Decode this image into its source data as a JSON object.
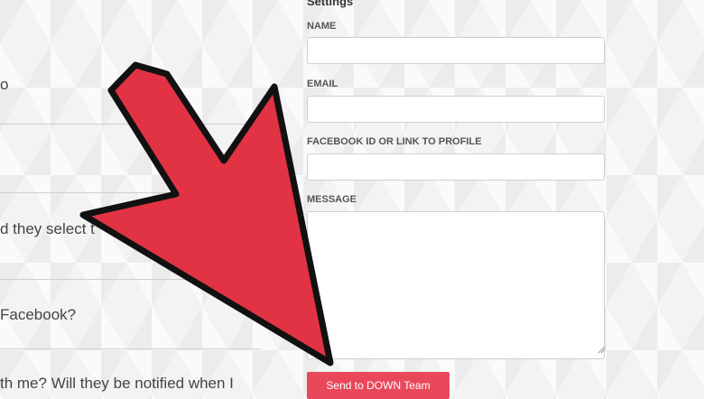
{
  "faq": {
    "items": [
      "o",
      "",
      "d they select t",
      "Facebook?",
      "th me? Will they be notified when I"
    ]
  },
  "settings": {
    "title": "Settings",
    "fields": {
      "name_label": "NAME",
      "email_label": "EMAIL",
      "facebook_label": "FACEBOOK ID OR LINK TO PROFILE",
      "message_label": "MESSAGE"
    },
    "values": {
      "name": "",
      "email": "",
      "facebook": "",
      "message": ""
    },
    "send_label": "Send to DOWN Team"
  },
  "annotation": {
    "arrow_color": "#e23344",
    "icon": "pointer-arrow-icon"
  },
  "colors": {
    "button": "#e9475a"
  }
}
